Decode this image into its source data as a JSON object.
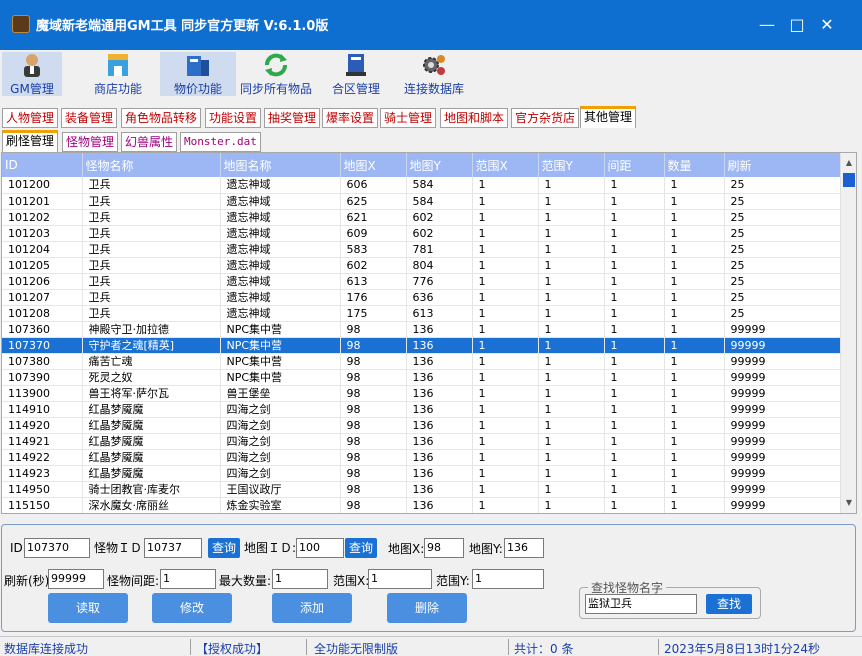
{
  "window": {
    "title": "魔域新老端通用GM工具 同步官方更新 V:6.1.0版"
  },
  "toolbar": [
    {
      "label": "GM管理",
      "icon": "user-icon"
    },
    {
      "label": "商店功能",
      "icon": "shop-icon"
    },
    {
      "label": "物价功能",
      "icon": "price-icon"
    },
    {
      "label": "同步所有物品",
      "icon": "sync-icon"
    },
    {
      "label": "合区管理",
      "icon": "server-icon"
    },
    {
      "label": "连接数据库",
      "icon": "database-icon"
    }
  ],
  "tabs": [
    "人物管理",
    "装备管理",
    "角色物品转移",
    "功能设置",
    "抽奖管理",
    "爆率设置",
    "骑士管理",
    "地图和脚本",
    "官方杂货店",
    "其他管理"
  ],
  "subtabs": [
    "刷怪管理",
    "怪物管理",
    "幻兽属性",
    "Monster.dat"
  ],
  "table": {
    "headers": [
      "ID",
      "怪物名称",
      "地图名称",
      "地图X",
      "地图Y",
      "范围X",
      "范围Y",
      "间距",
      "数量",
      "刷新"
    ],
    "rows": [
      [
        "101200",
        "卫兵",
        "遗忘神域",
        "606",
        "584",
        "1",
        "1",
        "1",
        "1",
        "25"
      ],
      [
        "101201",
        "卫兵",
        "遗忘神域",
        "625",
        "584",
        "1",
        "1",
        "1",
        "1",
        "25"
      ],
      [
        "101202",
        "卫兵",
        "遗忘神域",
        "621",
        "602",
        "1",
        "1",
        "1",
        "1",
        "25"
      ],
      [
        "101203",
        "卫兵",
        "遗忘神域",
        "609",
        "602",
        "1",
        "1",
        "1",
        "1",
        "25"
      ],
      [
        "101204",
        "卫兵",
        "遗忘神域",
        "583",
        "781",
        "1",
        "1",
        "1",
        "1",
        "25"
      ],
      [
        "101205",
        "卫兵",
        "遗忘神域",
        "602",
        "804",
        "1",
        "1",
        "1",
        "1",
        "25"
      ],
      [
        "101206",
        "卫兵",
        "遗忘神域",
        "613",
        "776",
        "1",
        "1",
        "1",
        "1",
        "25"
      ],
      [
        "101207",
        "卫兵",
        "遗忘神域",
        "176",
        "636",
        "1",
        "1",
        "1",
        "1",
        "25"
      ],
      [
        "101208",
        "卫兵",
        "遗忘神域",
        "175",
        "613",
        "1",
        "1",
        "1",
        "1",
        "25"
      ],
      [
        "107360",
        "神殿守卫·加拉德",
        "NPC集中营",
        "98",
        "136",
        "1",
        "1",
        "1",
        "1",
        "99999"
      ],
      [
        "107370",
        "守护者之魂[精英]",
        "NPC集中营",
        "98",
        "136",
        "1",
        "1",
        "1",
        "1",
        "99999"
      ],
      [
        "107380",
        "痛苦亡魂",
        "NPC集中营",
        "98",
        "136",
        "1",
        "1",
        "1",
        "1",
        "99999"
      ],
      [
        "107390",
        "死灵之奴",
        "NPC集中营",
        "98",
        "136",
        "1",
        "1",
        "1",
        "1",
        "99999"
      ],
      [
        "113900",
        "兽王将军·萨尔瓦",
        "兽王堡垒",
        "98",
        "136",
        "1",
        "1",
        "1",
        "1",
        "99999"
      ],
      [
        "114910",
        "红晶梦魇魔",
        "四海之剑",
        "98",
        "136",
        "1",
        "1",
        "1",
        "1",
        "99999"
      ],
      [
        "114920",
        "红晶梦魇魔",
        "四海之剑",
        "98",
        "136",
        "1",
        "1",
        "1",
        "1",
        "99999"
      ],
      [
        "114921",
        "红晶梦魇魔",
        "四海之剑",
        "98",
        "136",
        "1",
        "1",
        "1",
        "1",
        "99999"
      ],
      [
        "114922",
        "红晶梦魇魔",
        "四海之剑",
        "98",
        "136",
        "1",
        "1",
        "1",
        "1",
        "99999"
      ],
      [
        "114923",
        "红晶梦魇魔",
        "四海之剑",
        "98",
        "136",
        "1",
        "1",
        "1",
        "1",
        "99999"
      ],
      [
        "114950",
        "骑士团教官·库麦尔",
        "王国议政厅",
        "98",
        "136",
        "1",
        "1",
        "1",
        "1",
        "99999"
      ],
      [
        "115150",
        "深水魔女·席丽丝",
        "炼金实验室",
        "98",
        "136",
        "1",
        "1",
        "1",
        "1",
        "99999"
      ]
    ],
    "selected_id": "107370"
  },
  "form": {
    "id_label": "ID:",
    "id_value": "107370",
    "monster_id_label": "怪物ＩＤ",
    "monster_id_value": "10737",
    "query_label": "查询",
    "map_id_label": "地图ＩＤ:",
    "map_id_value": "100",
    "map_x_label": "地图X:",
    "map_x_value": "98",
    "map_y_label": "地图Y:",
    "map_y_value": "136",
    "refresh_label": "刷新(秒)",
    "refresh_value": "99999",
    "spacing_label": "怪物间距:",
    "spacing_value": "1",
    "max_label": "最大数量:",
    "max_value": "1",
    "range_x_label": "范围X:",
    "range_x_value": "1",
    "range_y_label": "范围Y:",
    "range_y_value": "1",
    "read_label": "读取",
    "modify_label": "修改",
    "add_label": "添加",
    "delete_label": "删除",
    "search_group_title": "查找怪物名字",
    "search_value": "监狱卫兵",
    "search_label": "查找"
  },
  "statusbar": {
    "db": "数据库连接成功",
    "auth": "【授权成功】",
    "edition": "全功能无限制版",
    "count": "共计：0 条",
    "datetime": "2023年5月8日13时1分24秒"
  },
  "colors": {
    "title_bar": "#0f6fd0",
    "selected_row": "#1b71d3",
    "header": "#9db7f5",
    "button": "#4a8fe0"
  }
}
